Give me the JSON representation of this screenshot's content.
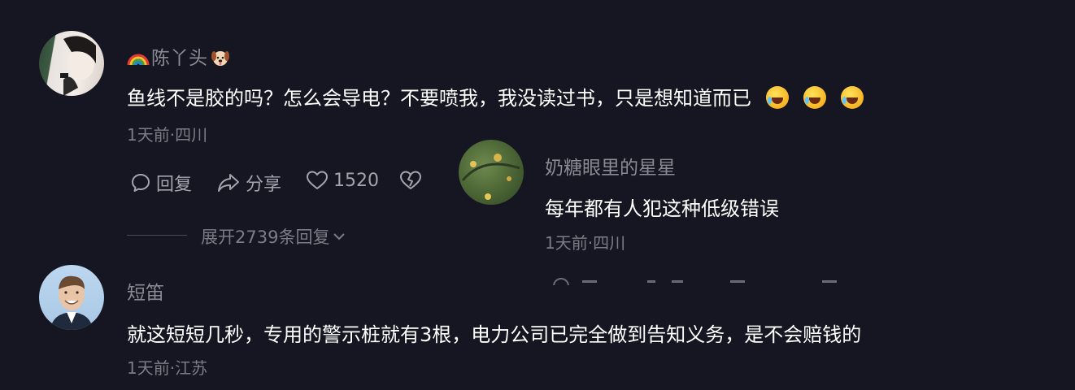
{
  "comments": [
    {
      "username": "陈丫头",
      "text": "鱼线不是胶的吗？怎么会导电？不要喷我，我没读过书，只是想知道而已",
      "trailing_emoji": [
        "laughing-tears-emoji",
        "laughing-tears-emoji",
        "laughing-tears-emoji"
      ],
      "meta": "1天前·四川",
      "actions": {
        "reply_label": "回复",
        "share_label": "分享",
        "like_count": "1520"
      },
      "expand_label": "展开2739条回复"
    },
    {
      "username": "奶糖眼里的星星",
      "text": "每年都有人犯这种低级错误",
      "meta": "1天前·四川"
    },
    {
      "username": "短笛",
      "text": "就这短短几秒，专用的警示桩就有3根，电力公司已完全做到告知义务，是不会赔钱的",
      "meta": "1天前·江苏"
    }
  ],
  "colors": {
    "background": "#161622",
    "username": "#8a8a93",
    "meta": "#7c7c86",
    "text": "#ffffff"
  },
  "icons": [
    "comment-bubble-icon",
    "share-arrow-icon",
    "heart-icon",
    "broken-heart-icon",
    "chevron-down-icon"
  ]
}
